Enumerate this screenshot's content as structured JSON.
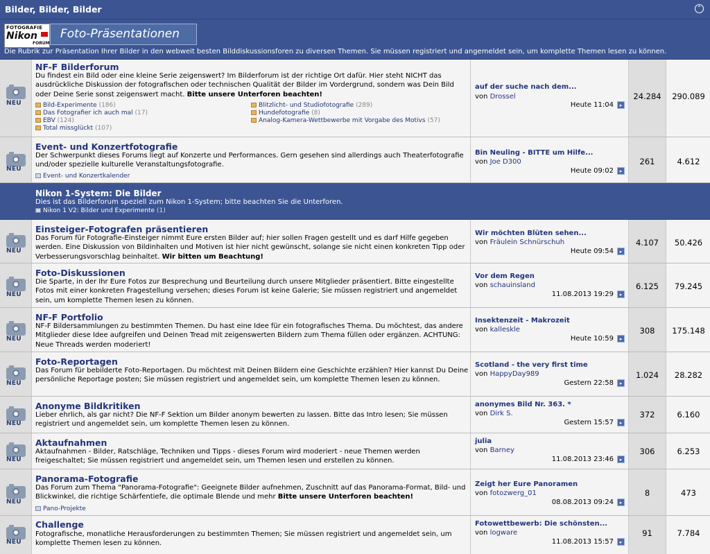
{
  "category": {
    "title": "Bilder, Bilder, Bilder",
    "collapse_icon": "collapse-icon",
    "banner": {
      "logo_line1": "FOTOGRAFIE",
      "logo_line2": "Nikon",
      "logo_line3": "FORUM",
      "title": "Foto-Präsentationen",
      "description": "Die Rubrik zur Präsentation Ihrer Bilder in den webweit besten Bilddiskussionsforen zu diversen Themen. Sie müssen registriert und angemeldet sein, um komplette Themen lesen zu können."
    }
  },
  "new_label": "NEU",
  "forums": [
    {
      "title": "NF-F Bilderforum",
      "desc_html": "Du findest ein Bild oder eine kleine Serie zeigenswert? Im Bilderforum ist der richtige Ort dafür. Hier steht NICHT das ausdrückliche Diskussion der fotografischen oder technischen Qualität der Bilder im Vordergrund, sondern was Dein Bild oder Deine Serie sonst zeigenswert macht. ",
      "desc_bold": "Bitte unsere Unterforen beachten!",
      "subforums": [
        {
          "label": "Bild-Experimente",
          "count": "(186)"
        },
        {
          "label": "Das Fotografier ich auch mal",
          "count": "(17)"
        },
        {
          "label": "EBV",
          "count": "(124)"
        },
        {
          "label": "Total missglückt",
          "count": "(107)"
        },
        {
          "label": "Blitzlicht- und Studiofotografie",
          "count": "(289)"
        },
        {
          "label": "Hundefotografie",
          "count": "(8)"
        },
        {
          "label": "Analog-Kamera-Wettbewerbe mit Vorgabe des Motivs",
          "count": "(57)"
        }
      ],
      "last_title": "auf der suche nach dem...",
      "last_by": "von",
      "last_user": "Drossel",
      "last_date": "Heute 11:04",
      "threads": "24.284",
      "posts": "290.089"
    },
    {
      "title": "Event- und Konzertfotografie",
      "desc_html": "Der Schwerpunkt dieses Forums liegt auf Konzerte und Performances. Gern gesehen sind allerdings auch Theaterfotografie und/oder spezielle kulturelle Veranstaltungsfotografie.",
      "desc_bold": "",
      "calendar": "Event- und Konzertkalender",
      "last_title": "Bin Neuling - BITTE um Hilfe...",
      "last_by": "von",
      "last_user": "Joe D300",
      "last_date": "Heute 09:02",
      "threads": "261",
      "posts": "4.612"
    },
    {
      "title": "Einsteiger-Fotografen präsentieren",
      "desc_html": "Das Forum für Fotografie-Einsteiger nimmt Eure ersten Bilder auf; hier sollen Fragen gestellt und es darf Hilfe gegeben werden. Eine Diskussion von Bildinhalten und Motiven ist hier nicht gewünscht, solange sie nicht einen konkreten Tipp oder Verbesserungsvorschlag beinhaltet. ",
      "desc_bold": "Wir bitten um Beachtung!",
      "last_title": "Wir möchten Blüten sehen...",
      "last_by": "von",
      "last_user": "Fräulein Schnürschuh",
      "last_date": "Heute 09:54",
      "threads": "4.107",
      "posts": "50.426"
    },
    {
      "title": "Foto-Diskussionen",
      "desc_html": "Die Sparte, in der Ihr Eure Fotos zur Besprechung und Beurteilung durch unsere Mitglieder präsentiert. Bitte eingestellte Fotos mit einer konkreten Fragestellung versehen; dieses Forum ist keine Galerie; Sie müssen registriert und angemeldet sein, um komplette Themen lesen zu können.",
      "desc_bold": "",
      "last_title": "Vor dem Regen",
      "last_by": "von",
      "last_user": "schauinsland",
      "last_date": "11.08.2013 19:29",
      "threads": "6.125",
      "posts": "79.245"
    },
    {
      "title": "NF-F Portfolio",
      "desc_html": "NF-F Bildersammlungen zu bestimmten Themen. Du hast eine Idee für ein fotografisches Thema. Du möchtest, das andere Mitglieder diese Idee aufgreifen und Deinen Tread mit zeigenswerten Bildern zum Thema füllen oder ergänzen. ACHTUNG: Neue Threads werden moderiert!",
      "desc_bold": "",
      "last_title": "Insektenzeit - Makrozeit",
      "last_by": "von",
      "last_user": "kalleskle",
      "last_date": "Heute 10:59",
      "threads": "308",
      "posts": "175.148"
    },
    {
      "title": "Foto-Reportagen",
      "desc_html": "Das Forum für bebilderte Foto-Reportagen. Du möchtest mit Deinen Bildern eine Geschichte erzählen? Hier kannst Du Deine persönliche Reportage posten; Sie müssen registriert und angemeldet sein, um komplette Themen lesen zu können.",
      "desc_bold": "",
      "last_title": "Scotland - the very first time",
      "last_by": "von",
      "last_user": "HappyDay989",
      "last_date": "Gestern 22:58",
      "threads": "1.024",
      "posts": "28.282"
    },
    {
      "title": "Anonyme Bildkritiken",
      "desc_html": "Lieber ehrlich, als gar nicht? Die NF-F Sektion um Bilder anonym bewerten zu lassen. Bitte das Intro lesen; Sie müssen registriert und angemeldet sein, um komplette Themen lesen zu können.",
      "desc_bold": "",
      "last_title": "anonymes Bild Nr. 363. *",
      "last_by": "von",
      "last_user": "Dirk S.",
      "last_date": "Gestern 15:57",
      "threads": "372",
      "posts": "6.160"
    },
    {
      "title": "Aktaufnahmen",
      "desc_html": "Aktaufnahmen - Bilder, Ratschläge, Techniken und Tipps - dieses Forum wird moderiert - neue Themen werden freigeschaltet; Sie müssen registriert und angemeldet sein, um Themen lesen und erstellen zu können.",
      "desc_bold": "",
      "last_title": "julia",
      "last_by": "von",
      "last_user": "Barney",
      "last_date": "11.08.2013 23:46",
      "threads": "306",
      "posts": "6.253"
    },
    {
      "title": "Panorama-Fotografie",
      "desc_html": "Das Forum zum Thema \"Panorama-Fotografie\": Geeignete Bilder aufnehmen, Zuschnitt auf das Panorama-Format, Bild- und Blickwinkel, die richtige Schärfentiefe, die optimale Blende und mehr ",
      "desc_bold": "Bitte unsere Unterforen beachten!",
      "subforum_single": "Pano-Projekte",
      "last_title": "Zeigt her Eure Panoramen",
      "last_by": "von",
      "last_user": "fotozwerg_01",
      "last_date": "08.08.2013 09:24",
      "threads": "8",
      "posts": "473"
    },
    {
      "title": "Challenge",
      "desc_html": "Fotografische, monatliche Herausforderungen zu bestimmten Themen; Sie müssen registriert und angemeldet sein, um komplette Themen lesen zu können.",
      "desc_bold": "",
      "last_title": "Fotowettbewerb: Die schönsten...",
      "last_by": "von",
      "last_user": "logware",
      "last_date": "11.08.2013 15:57",
      "threads": "91",
      "posts": "7.784"
    }
  ],
  "section": {
    "title": "Nikon 1-System: Die Bilder",
    "desc": "Dies ist das Bilderforum speziell zum Nikon 1-System; bitte beachten Sie die Unterforen.",
    "sub_label": "Nikon 1 V2: Bilder und Experimente",
    "sub_count": "(1)"
  }
}
